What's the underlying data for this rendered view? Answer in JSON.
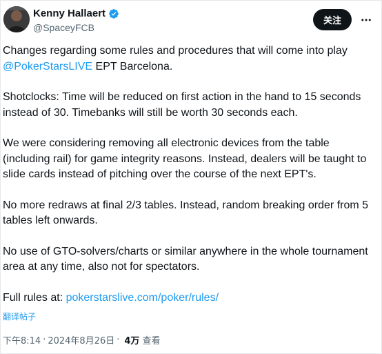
{
  "author": {
    "display_name": "Kenny Hallaert",
    "handle": "@SpaceyFCB",
    "verified_color": "#1d9bf0"
  },
  "header": {
    "follow_label": "关注",
    "more_icon": "more-horizontal-icon"
  },
  "tweet": {
    "p1_text": "Changes regarding some rules and procedures that will come into play",
    "p1_mention": "@PokerStarsLIVE",
    "p1_tail": " EPT Barcelona.",
    "p2": "Shotclocks: Time will be reduced on first action in the hand to 15 seconds instead of 30. Timebanks will still be worth 30 seconds each.",
    "p3": "We were considering removing all electronic devices from the table (including rail) for game integrity reasons. Instead, dealers will be taught to slide cards instead of pitching over the course of the next EPT's.",
    "p4": "No more redraws at final 2/3 tables. Instead, random breaking order from 5 tables left onwards.",
    "p5": "No use of GTO-solvers/charts or similar anywhere in the whole tournament area at any time, also not for spectators.",
    "p6_text": "Full rules at: ",
    "p6_link": "pokerstarslive.com/poker/rules/"
  },
  "translate_label": "翻译帖子",
  "meta": {
    "time": "下午8:14",
    "separator": "·",
    "date": "2024年8月26日",
    "views_count": "4万",
    "views_label": "查看"
  },
  "colors": {
    "accent": "#1d9bf0",
    "text": "#0f1419",
    "secondary": "#536471"
  }
}
